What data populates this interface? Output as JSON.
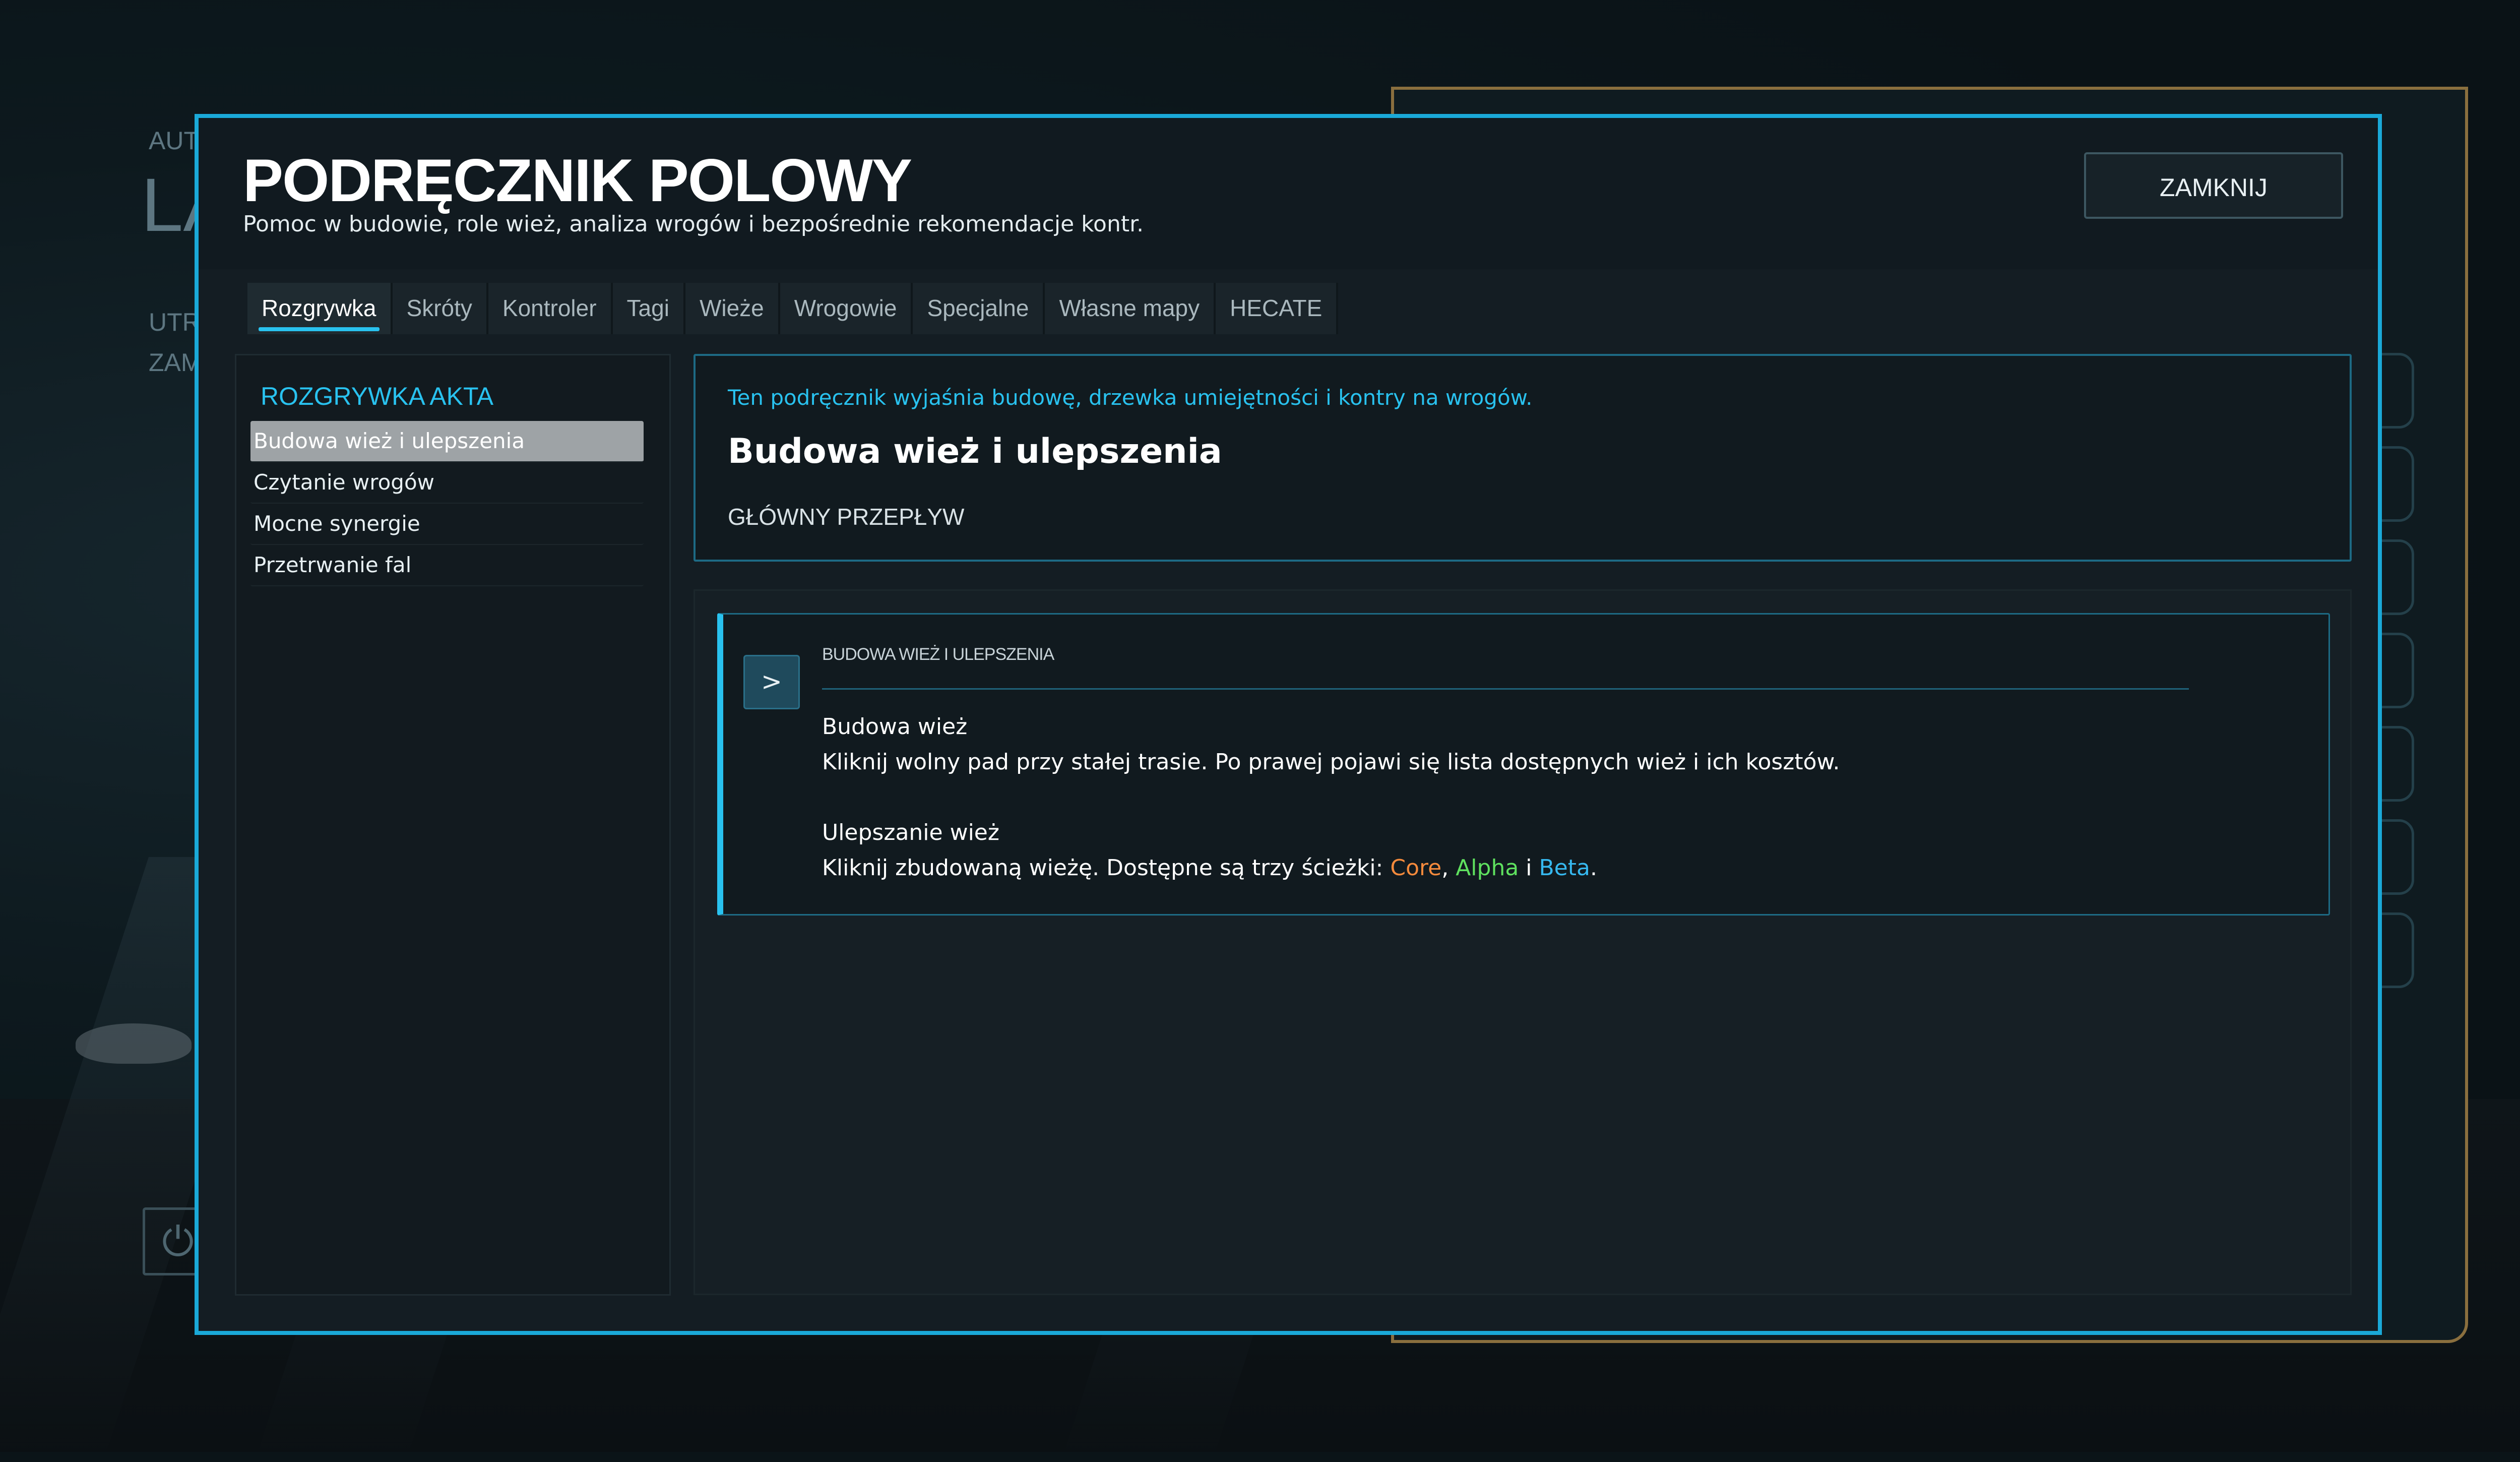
{
  "background": {
    "label_a": "AUT",
    "label_b": "LA",
    "label_c": "UTR",
    "label_d": "ZAM"
  },
  "window": {
    "title": "PODRĘCZNIK POLOWY",
    "subtitle": "Pomoc w budowie, role wież, analiza wrogów i bezpośrednie rekomendacje kontr.",
    "close_label": "ZAMKNIJ"
  },
  "tabs": [
    {
      "label": "Rozgrywka",
      "active": true
    },
    {
      "label": "Skróty"
    },
    {
      "label": "Kontroler"
    },
    {
      "label": "Tagi"
    },
    {
      "label": "Wieże"
    },
    {
      "label": "Wrogowie"
    },
    {
      "label": "Specjalne"
    },
    {
      "label": "Własne mapy"
    },
    {
      "label": "HECATE"
    }
  ],
  "sidebar": {
    "title": "ROZGRYWKA AKTA",
    "items": [
      {
        "label": "Budowa wież i ulepszenia",
        "active": true
      },
      {
        "label": "Czytanie wrogów"
      },
      {
        "label": "Mocne synergie"
      },
      {
        "label": "Przetrwanie fal"
      }
    ]
  },
  "intro": {
    "hint": "Ten podręcznik wyjaśnia budowę, drzewka umiejętności i kontry na wrogów.",
    "title": "Budowa wież i ulepszenia",
    "section": "GŁÓWNY PRZEPŁYW"
  },
  "entry": {
    "chevron": ">",
    "label": "BUDOWA WIEŻ I ULEPSZENIA",
    "heading1": "Budowa wież",
    "text1": "Kliknij wolny pad przy stałej trasie. Po prawej pojawi się lista dostępnych wież i ich kosztów.",
    "heading2": "Ulepszanie wież",
    "text2_prefix": "Kliknij zbudowaną wieżę. Dostępne są trzy ścieżki: ",
    "path_core": "Core",
    "sep1": ", ",
    "path_alpha": "Alpha",
    "sep2": " i ",
    "path_beta": "Beta",
    "end": ".",
    "colors": {
      "core": "#f58a3c",
      "alpha": "#5fe15f",
      "beta": "#36b8ef"
    }
  },
  "colors": {
    "accent": "#29c2ef",
    "frame": "#1aa9d8",
    "panel": "#141d23"
  }
}
